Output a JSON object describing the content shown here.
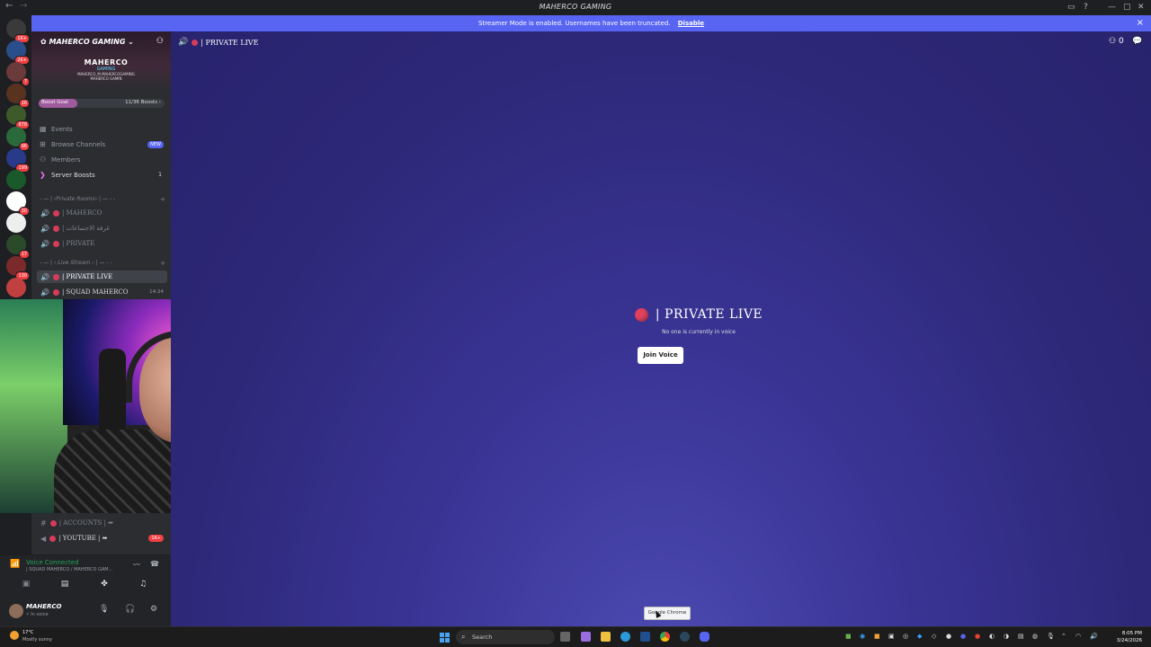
{
  "window": {
    "title": "MAHERCO GAMING",
    "back": "←",
    "forward": "→"
  },
  "banner": {
    "text": "Streamer Mode is enabled. Usernames have been truncated.",
    "disable": "Disable",
    "close": "×"
  },
  "servers": [
    {
      "color": "#3a3a3a",
      "badge": "1K+"
    },
    {
      "color": "#2a4e8a",
      "badge": "2K+"
    },
    {
      "color": "#6b3a3a",
      "badge": "7"
    },
    {
      "color": "#5a3320",
      "badge": "16"
    },
    {
      "color": "#3f5a2a",
      "badge": "878"
    },
    {
      "color": "#2a6a3a",
      "badge": "96"
    },
    {
      "color": "#2a3a8a",
      "badge": "199"
    },
    {
      "color": "#1a5a2a",
      "badge": ""
    },
    {
      "color": "#ffffff",
      "badge": "30"
    },
    {
      "color": "#eeeeee",
      "badge": ""
    },
    {
      "color": "#2a4a2a",
      "badge": "17"
    },
    {
      "color": "#7a2a2a",
      "badge": "130"
    },
    {
      "color": "#c04040",
      "badge": ""
    }
  ],
  "server_header": {
    "name": "MAHERCO GAMING",
    "logo_line1": "MAHERCO",
    "logo_line2": "GAMING",
    "logo_line3": "MAHERCO_M   MAHERCOGAMING",
    "logo_line4": "MAHERCO GAMIN",
    "invite_icon": "person-add-icon"
  },
  "boost": {
    "label": "Boost Goal",
    "count": "11/36 Boosts ›",
    "progress": 0.31
  },
  "nav": [
    {
      "label": "Events",
      "icon": "▦"
    },
    {
      "label": "Browse Channels",
      "icon": "⊞",
      "badge": "NEW"
    },
    {
      "label": "Members",
      "icon": "👥"
    },
    {
      "label": "Server Boosts",
      "icon": "❯",
      "count": "1"
    }
  ],
  "categories": [
    {
      "label": "- — | ‹Private Rooms› | — - -"
    },
    {
      "label": "- — | ‹ Live Stream › | — - -"
    }
  ],
  "channels": [
    {
      "label": "| MAHERCO",
      "active": false
    },
    {
      "label": "| غرفة الاجتماعات",
      "active": false
    },
    {
      "label": "| PRIVATE",
      "active": false
    },
    {
      "label": "| PRIVATE LIVE",
      "active": true
    },
    {
      "label": "| SQUAD MAHERCO",
      "active": false,
      "time": "14:24"
    }
  ],
  "bottom_channels": [
    {
      "label": "| ACCOUNTS | ➡",
      "kind": "#"
    },
    {
      "label": "| YOUTUBE | ➡",
      "kind": "📢",
      "badge": "1K+"
    }
  ],
  "voice": {
    "status": "Voice Connected",
    "sub": "| SQUAD MAHERCO / MAHERCO GAM...",
    "btn_video": "▣",
    "btn_screen": "▤",
    "btn_activity": "✤",
    "btn_sound": "♫"
  },
  "user": {
    "name": "MAHERCO",
    "status": "In voice"
  },
  "main": {
    "channel_name": "| PRIVATE LIVE",
    "user_count": "0",
    "center_title": "| PRIVATE LIVE",
    "center_sub": "No one is currently in voice",
    "join_label": "Join Voice",
    "tooltip": "Google Chrome"
  },
  "taskbar": {
    "temp": "17°C",
    "weather": "Mostly sunny",
    "search_placeholder": "Search",
    "time": "8:05 PM",
    "date": "3/24/2026"
  }
}
